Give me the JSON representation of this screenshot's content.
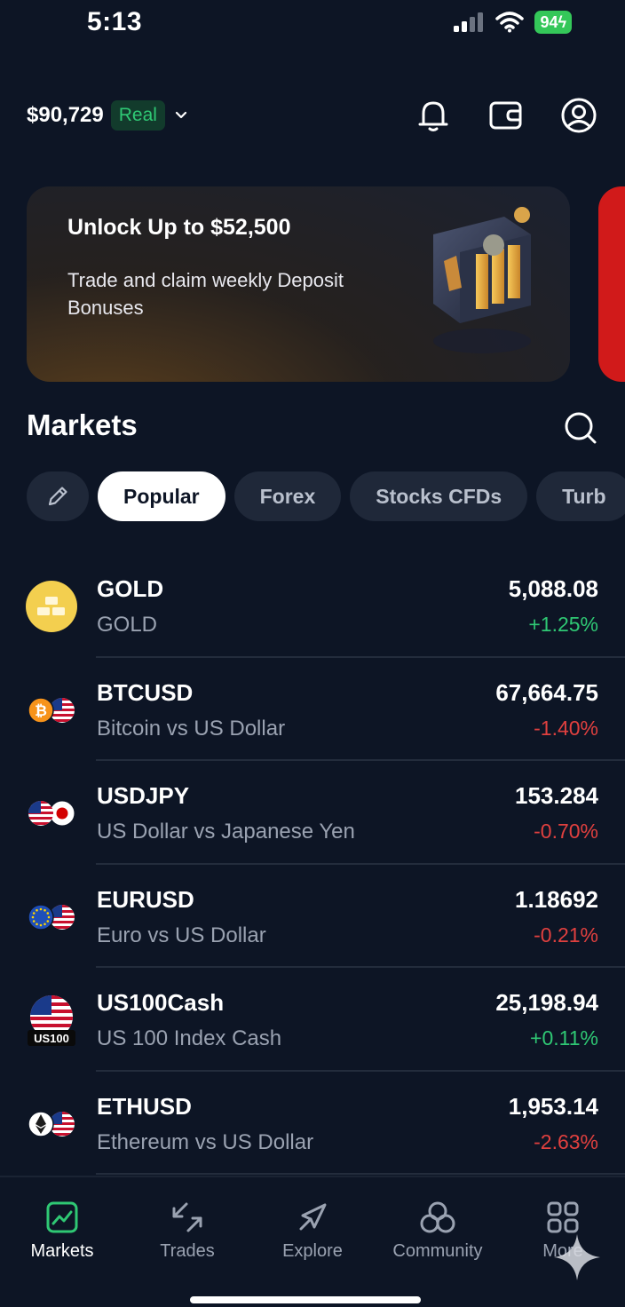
{
  "status_bar": {
    "time": "5:13",
    "battery": "94"
  },
  "header": {
    "balance": "$90,729",
    "account_type": "Real"
  },
  "promo": {
    "title": "Unlock Up to $52,500",
    "subtitle": "Trade and claim weekly Deposit Bonuses"
  },
  "markets": {
    "title": "Markets",
    "chips": [
      {
        "label": "Popular",
        "active": true
      },
      {
        "label": "Forex"
      },
      {
        "label": "Stocks CFDs"
      },
      {
        "label": "Turb"
      }
    ],
    "items": [
      {
        "symbol": "GOLD",
        "name": "GOLD",
        "price": "5,088.08",
        "change": "+1.25%",
        "direction": "up",
        "icon": "gold-bars-icon"
      },
      {
        "symbol": "BTCUSD",
        "name": "Bitcoin vs US Dollar",
        "price": "67,664.75",
        "change": "-1.40%",
        "direction": "down",
        "icon": "bitcoin-usd-flag-icon"
      },
      {
        "symbol": "USDJPY",
        "name": "US Dollar vs Japanese Yen",
        "price": "153.284",
        "change": "-0.70%",
        "direction": "down",
        "icon": "usd-jpy-flag-icon"
      },
      {
        "symbol": "EURUSD",
        "name": "Euro vs US Dollar",
        "price": "1.18692",
        "change": "-0.21%",
        "direction": "down",
        "icon": "eur-usd-flag-icon"
      },
      {
        "symbol": "US100Cash",
        "name": "US 100 Index Cash",
        "price": "25,198.94",
        "change": "+0.11%",
        "direction": "up",
        "icon": "us100-flag-icon",
        "badge": "US100"
      },
      {
        "symbol": "ETHUSD",
        "name": "Ethereum vs US Dollar",
        "price": "1,953.14",
        "change": "-2.63%",
        "direction": "down",
        "icon": "ethereum-usd-flag-icon"
      }
    ]
  },
  "nav": [
    {
      "label": "Markets",
      "icon": "chart-icon",
      "active": true
    },
    {
      "label": "Trades",
      "icon": "trades-arrows-icon"
    },
    {
      "label": "Explore",
      "icon": "compass-icon"
    },
    {
      "label": "Community",
      "icon": "community-icon"
    },
    {
      "label": "More",
      "icon": "grid-icon"
    }
  ],
  "colors": {
    "background": "#0d1525",
    "positive": "#2fc874",
    "negative": "#e0403f",
    "accent_green": "#2fc874",
    "promo_next": "#d11a1a"
  }
}
